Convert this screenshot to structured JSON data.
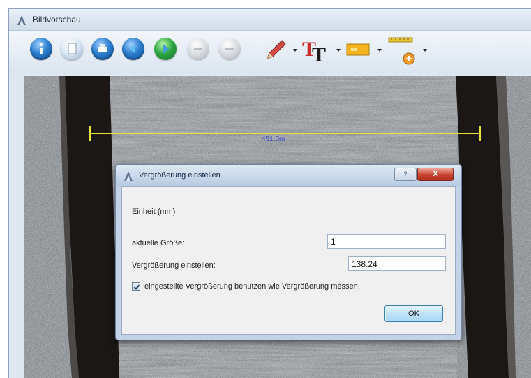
{
  "window": {
    "title": "Bildvorschau"
  },
  "toolbar": {
    "buttons": [
      {
        "icon": "info-icon"
      },
      {
        "icon": "new-document-icon"
      },
      {
        "icon": "print-icon"
      },
      {
        "icon": "back-icon"
      },
      {
        "icon": "forward-icon"
      },
      {
        "icon": "zoom-out-icon"
      },
      {
        "icon": "zoom-in-icon"
      }
    ],
    "tools": [
      {
        "icon": "pencil-icon"
      },
      {
        "icon": "text-tool-icon"
      },
      {
        "icon": "color-fill-icon"
      },
      {
        "icon": "measure-tool-icon"
      }
    ]
  },
  "image": {
    "measurement_label": "451.0m"
  },
  "dialog": {
    "title": "Vergrößerung einstellen",
    "help_label": "?",
    "close_label": "X",
    "unit_label": "Einheit (mm)",
    "current_size_label": "aktuelle Größe:",
    "current_size_value": "1",
    "magnification_label": "Vergrößerung einstellen:",
    "magnification_value": "138.24",
    "checkbox_label": "eingestellte Vergrößerung benutzen wie Vergrößerung messen.",
    "checkbox_checked": true,
    "ok_label": "OK"
  },
  "colors": {
    "measure_line": "#e8e23a",
    "measure_text": "#2f42c8",
    "close_button": "#c8432f"
  }
}
